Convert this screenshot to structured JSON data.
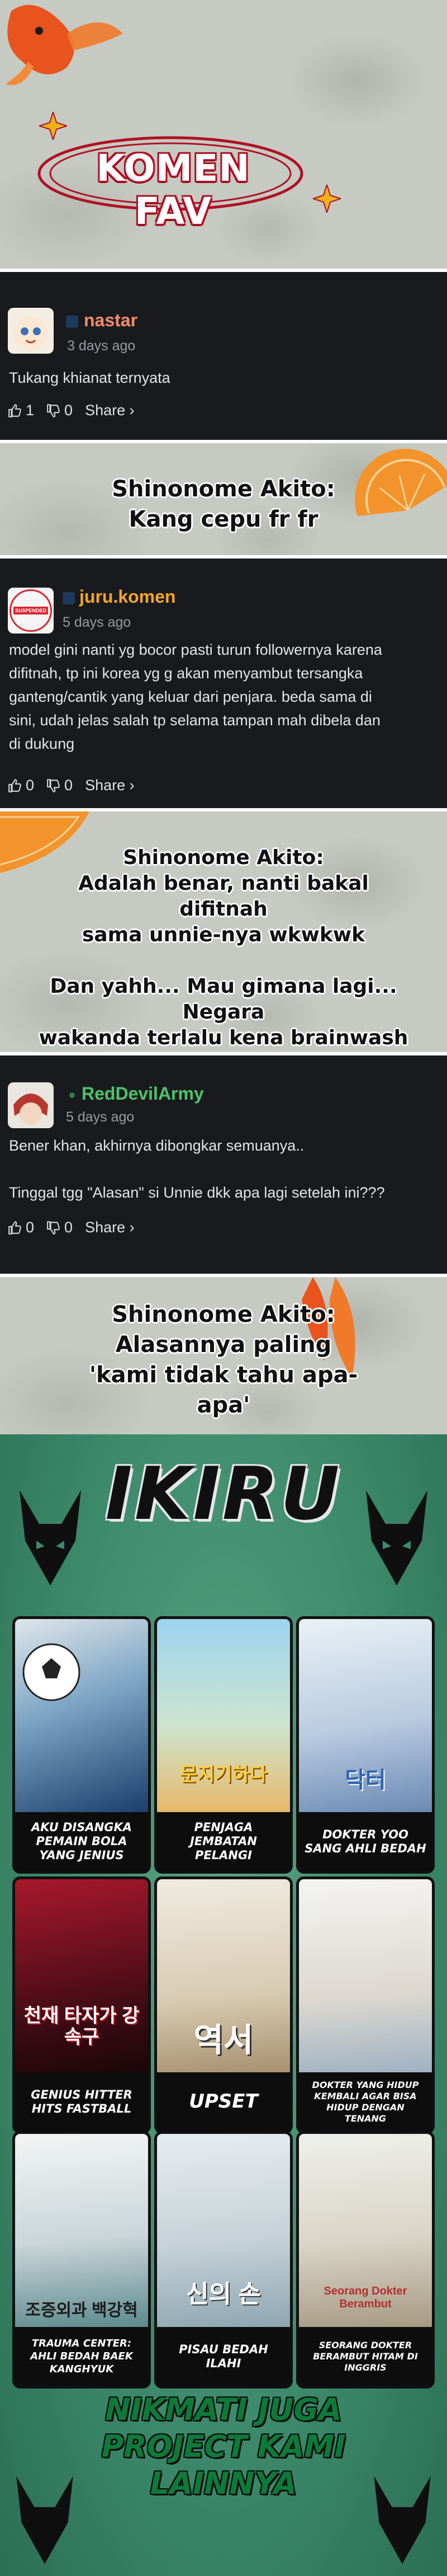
{
  "header": {
    "title": "KOMEN FAV"
  },
  "comments": [
    {
      "username": "nastar",
      "time": "3 days ago",
      "body": [
        "Tukang khianat ternyata"
      ],
      "likes": "1",
      "dislikes": "0",
      "share_label": "Share ›",
      "username_color": "#f28b6a"
    },
    {
      "username": "juru.komen",
      "time": "5 days ago",
      "avatar_text": "SUSPENDED",
      "body": [
        "model gini nanti yg bocor pasti turun followernya karena",
        "difitnah, tp ini korea yg g akan menyambut tersangka",
        "ganteng/cantik yang keluar dari penjara. beda sama di",
        "sini, udah jelas salah tp selama tampan mah dibela dan",
        "di dukung"
      ],
      "likes": "0",
      "dislikes": "0",
      "share_label": "Share ›",
      "username_color": "#f5a623"
    },
    {
      "username": "RedDevilArmy",
      "time": "5 days ago",
      "body": [
        "Bener khan, akhirnya dibongkar semuanya..",
        "",
        "Tinggal tgg \"Alasan\" si Unnie dkk apa lagi setelah ini???"
      ],
      "likes": "0",
      "dislikes": "0",
      "share_label": "Share ›",
      "username_color": "#4cc46a"
    }
  ],
  "replies": [
    {
      "lines": [
        "Shinonome Akito:",
        "Kang cepu fr fr"
      ]
    },
    {
      "lines": [
        "Shinonome Akito:",
        "Adalah benar, nanti bakal difitnah",
        "sama unnie-nya wkwkwk",
        "",
        "Dan yahh... Mau gimana lagi... Negara",
        "wakanda terlalu kena brainwash"
      ]
    },
    {
      "lines": [
        "Shinonome Akito:",
        "Alasannya paling",
        "'kami tidak tahu apa-apa'"
      ]
    }
  ],
  "poster": {
    "brand": "IKIRU",
    "tiles": [
      {
        "label": "AKU DISANGKA PEMAIN BOLA YANG JENIUS"
      },
      {
        "label": "PENJAGA JEMBATAN PELANGI"
      },
      {
        "label": "DOKTER YOO SANG AHLI BEDAH"
      },
      {
        "label": "GENIUS HITTER HITS FASTBALL"
      },
      {
        "label": "UPSET"
      },
      {
        "label": "DOKTER YANG HIDUP KEMBALI AGAR BISA HIDUP DENGAN TENANG"
      },
      {
        "label": "TRAUMA CENTER: AHLI BEDAH BAEK KANGHYUK"
      },
      {
        "label": "PISAU BEDAH ILAHI"
      },
      {
        "label": "SEORANG DOKTER BERAMBUT HITAM DI INGGRIS"
      }
    ],
    "art_text": [
      "",
      "문지기하다",
      "닥터",
      "천재 타자가 강속구",
      "역서",
      "",
      "조증외과 백강혁",
      "신의 손",
      "Seorang Dokter Berambut"
    ],
    "promo": [
      "NIKMATI JUGA",
      "PROJECT KAMI",
      "LAINNYA"
    ]
  },
  "colors": {
    "card_bg": "#191a1d",
    "poster_green": "#3d8a6c",
    "title_red": "#b00f24"
  }
}
